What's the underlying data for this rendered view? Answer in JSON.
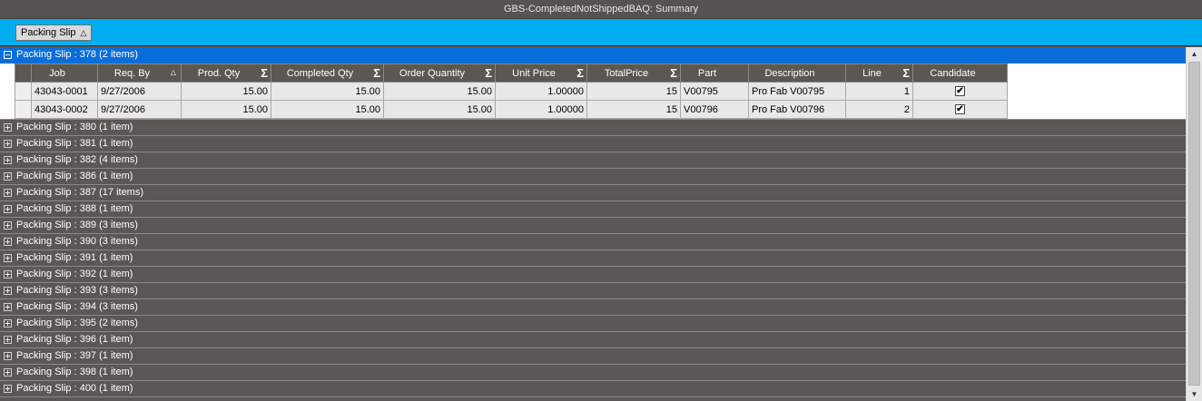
{
  "window": {
    "title": "GBS-CompletedNotShippedBAQ: Summary"
  },
  "groupby": {
    "chip_label": "Packing Slip",
    "sort_glyph": "△"
  },
  "expanded_group": {
    "label": "Packing Slip : 378 (2 items)"
  },
  "columns": {
    "job": "Job",
    "req_by": "Req. By",
    "prod_qty": "Prod. Qty",
    "completed_qty": "Completed Qty",
    "order_quantity": "Order Quantity",
    "unit_price": "Unit Price",
    "total_price": "TotalPrice",
    "part": "Part",
    "description": "Description",
    "line": "Line",
    "candidate": "Candidate",
    "sigma_glyph": "Σ",
    "sort_glyph": "△"
  },
  "rows": [
    {
      "job": "43043-0001",
      "req_by": "9/27/2006",
      "prod_qty": "15.00",
      "completed_qty": "15.00",
      "order_quantity": "15.00",
      "unit_price": "1.00000",
      "total_price": "15",
      "part": "V00795",
      "description": "Pro Fab V00795",
      "line": "1",
      "candidate": "✔"
    },
    {
      "job": "43043-0002",
      "req_by": "9/27/2006",
      "prod_qty": "15.00",
      "completed_qty": "15.00",
      "order_quantity": "15.00",
      "unit_price": "1.00000",
      "total_price": "15",
      "part": "V00796",
      "description": "Pro Fab V00796",
      "line": "2",
      "candidate": "✔"
    }
  ],
  "groups": [
    "Packing Slip : 380 (1 item)",
    "Packing Slip : 381 (1 item)",
    "Packing Slip : 382 (4 items)",
    "Packing Slip : 386 (1 item)",
    "Packing Slip : 387 (17 items)",
    "Packing Slip : 388 (1 item)",
    "Packing Slip : 389 (3 items)",
    "Packing Slip : 390 (3 items)",
    "Packing Slip : 391 (1 item)",
    "Packing Slip : 392 (1 item)",
    "Packing Slip : 393 (3 items)",
    "Packing Slip : 394 (3 items)",
    "Packing Slip : 395 (2 items)",
    "Packing Slip : 396 (1 item)",
    "Packing Slip : 397 (1 item)",
    "Packing Slip : 398 (1 item)",
    "Packing Slip : 400 (1 item)"
  ],
  "scrollbar": {
    "up_glyph": "▲",
    "down_glyph": "▼"
  },
  "colors": {
    "header_band": "#00adef",
    "selected_group": "#0a6ed8",
    "grid_bg": "#5a5754"
  }
}
